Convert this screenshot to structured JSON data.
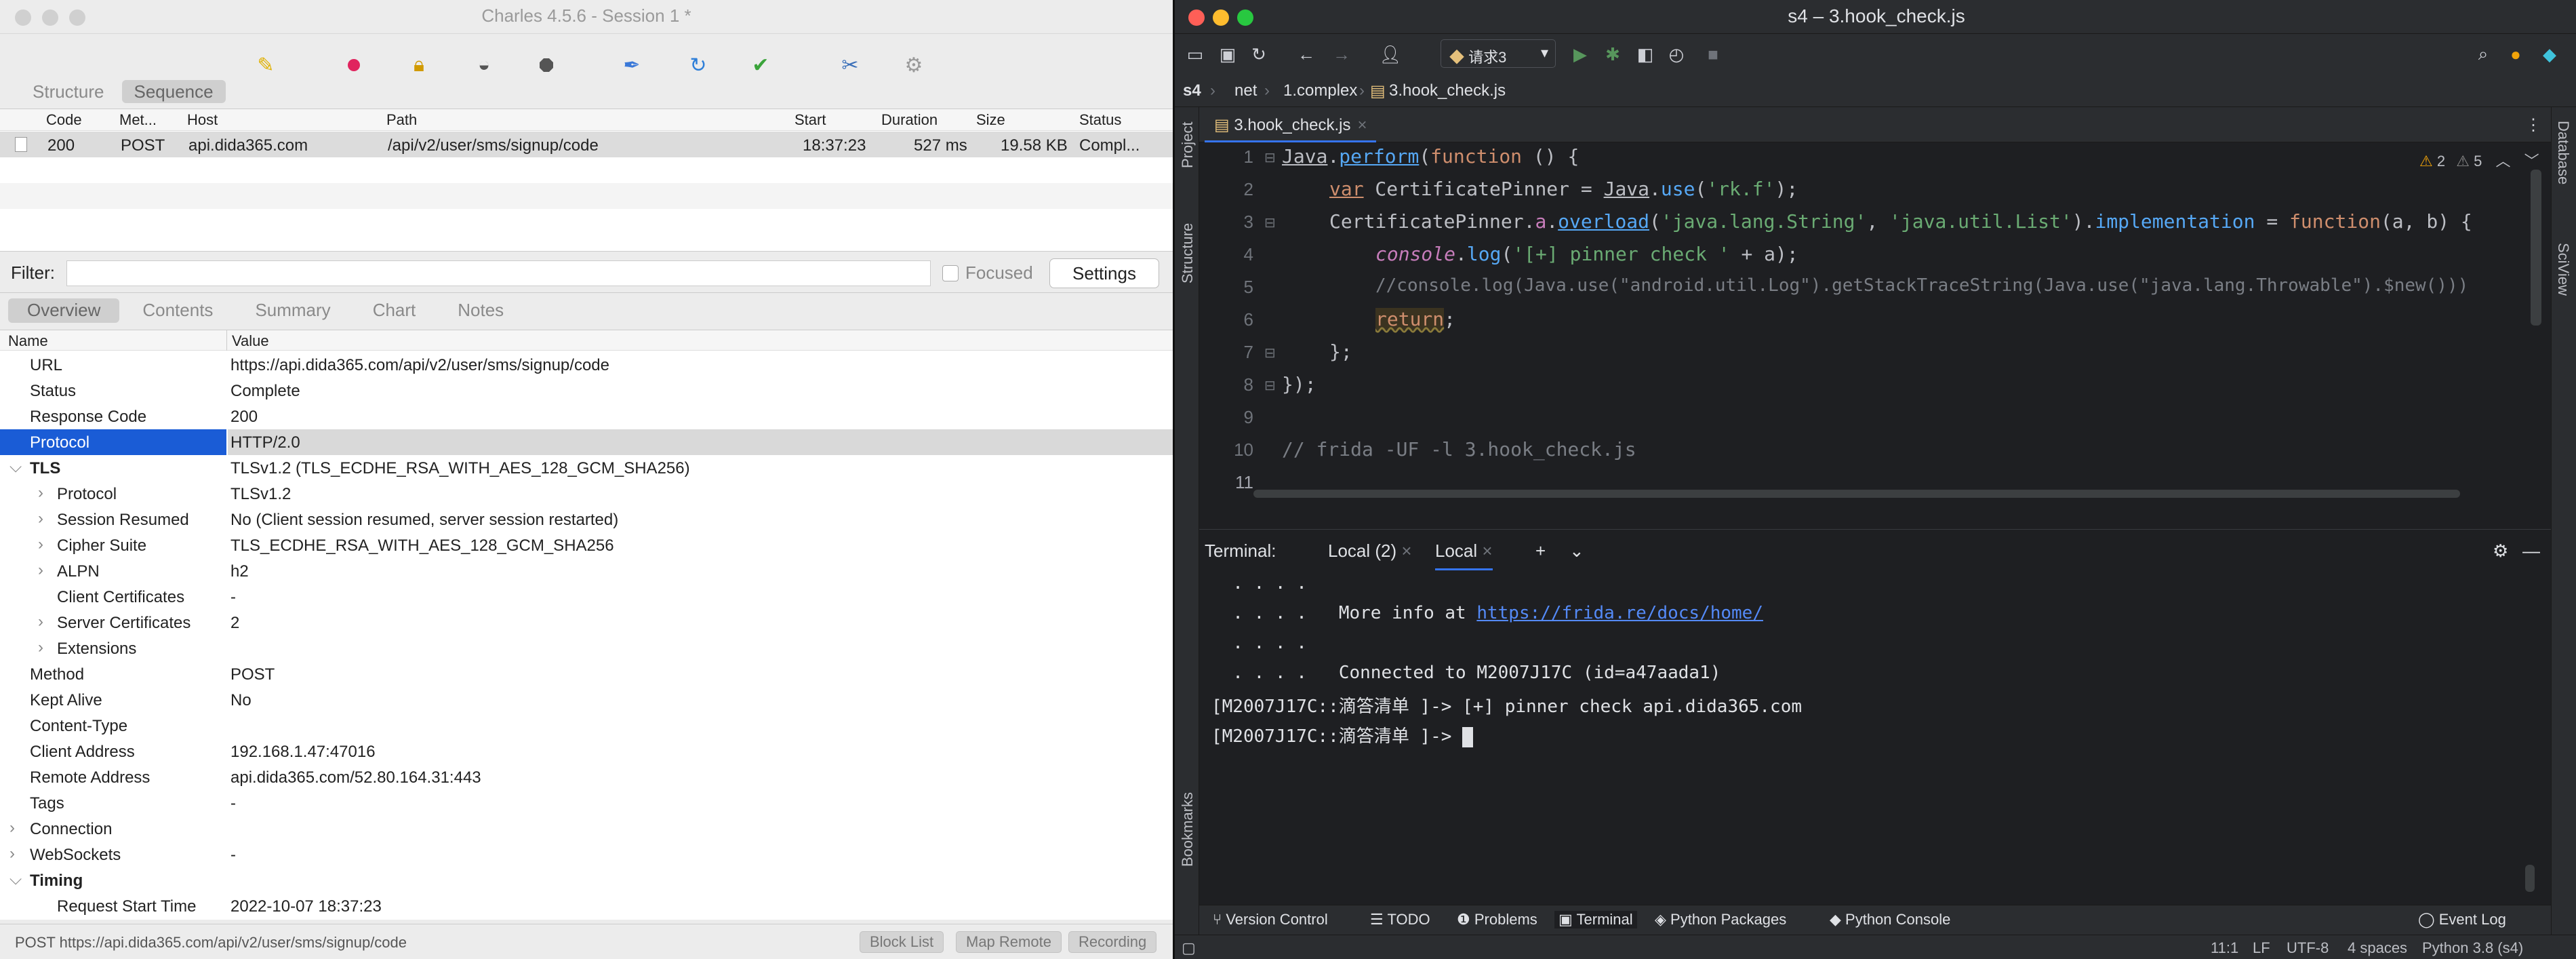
{
  "charles": {
    "title": "Charles 4.5.6 - Session 1 *",
    "view_tabs": [
      "Structure",
      "Sequence"
    ],
    "sequence_columns": [
      "Code",
      "Met...",
      "Host",
      "Path",
      "Start",
      "Duration",
      "Size",
      "Status"
    ],
    "sequence_rows": [
      {
        "code": "200",
        "method": "POST",
        "host": "api.dida365.com",
        "path": "/api/v2/user/sms/signup/code",
        "start": "18:37:23",
        "duration": "527 ms",
        "size": "19.58 KB",
        "status": "Compl..."
      }
    ],
    "filter_label": "Filter:",
    "focused_label": "Focused",
    "settings_label": "Settings",
    "detail_tabs": [
      "Overview",
      "Contents",
      "Summary",
      "Chart",
      "Notes"
    ],
    "detail_columns": [
      "Name",
      "Value"
    ],
    "detail_rows": [
      {
        "name": "URL",
        "value": "https://api.dida365.com/api/v2/user/sms/signup/code"
      },
      {
        "name": "Status",
        "value": "Complete"
      },
      {
        "name": "Response Code",
        "value": "200"
      },
      {
        "name": "Protocol",
        "value": "HTTP/2.0"
      },
      {
        "name": "TLS",
        "value": "TLSv1.2 (TLS_ECDHE_RSA_WITH_AES_128_GCM_SHA256)"
      },
      {
        "name": "Protocol",
        "value": "TLSv1.2"
      },
      {
        "name": "Session Resumed",
        "value": "No (Client session resumed, server session restarted)"
      },
      {
        "name": "Cipher Suite",
        "value": "TLS_ECDHE_RSA_WITH_AES_128_GCM_SHA256"
      },
      {
        "name": "ALPN",
        "value": "h2"
      },
      {
        "name": "Client Certificates",
        "value": "-"
      },
      {
        "name": "Server Certificates",
        "value": "2"
      },
      {
        "name": "Extensions",
        "value": ""
      },
      {
        "name": "Method",
        "value": "POST"
      },
      {
        "name": "Kept Alive",
        "value": "No"
      },
      {
        "name": "Content-Type",
        "value": ""
      },
      {
        "name": "Client Address",
        "value": "192.168.1.47:47016"
      },
      {
        "name": "Remote Address",
        "value": "api.dida365.com/52.80.164.31:443"
      },
      {
        "name": "Tags",
        "value": "-"
      },
      {
        "name": "Connection",
        "value": ""
      },
      {
        "name": "WebSockets",
        "value": "-"
      },
      {
        "name": "Timing",
        "value": ""
      },
      {
        "name": "Request Start Time",
        "value": "2022-10-07 18:37:23"
      }
    ],
    "status_text": "POST https://api.dida365.com/api/v2/user/sms/signup/code",
    "status_buttons": [
      "Block List",
      "Map Remote",
      "Recording"
    ]
  },
  "ide": {
    "title": "s4 – 3.hook_check.js",
    "run_config": "请求3",
    "breadcrumb": [
      "s4",
      "net",
      "1.complex",
      "3.hook_check.js"
    ],
    "editor_tab": "3.hook_check.js",
    "inspections": {
      "warnings": "2",
      "weak_warnings": "5"
    },
    "line_numbers": [
      "1",
      "2",
      "3",
      "4",
      "5",
      "6",
      "7",
      "8",
      "9",
      "10",
      "11"
    ],
    "code": {
      "l1": [
        "Java",
        ".",
        "perform",
        "(",
        "function",
        " () {"
      ],
      "l2": [
        "var",
        " CertificatePinner = ",
        "Java",
        ".",
        "use",
        "(",
        "'rk.f'",
        ");"
      ],
      "l3": [
        "CertificatePinner.",
        "a",
        ".",
        "overload",
        "(",
        "'java.lang.String'",
        ", ",
        "'java.util.List'",
        ").",
        "implementation",
        " = ",
        "function",
        "(a, b) {"
      ],
      "l4": [
        "console",
        ".",
        "log",
        "(",
        "'[+] pinner check '",
        " + a);"
      ],
      "l5": "//console.log(Java.use(\"android.util.Log\").getStackTraceString(Java.use(\"java.lang.Throwable\").$new()))",
      "l6": [
        "return",
        ";"
      ],
      "l7": "};",
      "l8": "});",
      "l10": "// frida -UF -l 3.hook_check.js"
    },
    "terminal": {
      "label": "Terminal:",
      "tabs": [
        "Local (2)",
        "Local"
      ],
      "lines": [
        "  . . . .",
        "  . . . .   More info at ",
        "  . . . .",
        "  . . . .   Connected to M2007J17C (id=a47aada1)",
        "[M2007J17C::滴答清单 ]-> [+] pinner check api.dida365.com",
        "[M2007J17C::滴答清单 ]-> "
      ],
      "link": "https://frida.re/docs/home/"
    },
    "left_strip": [
      "Project",
      "Structure",
      "Bookmarks"
    ],
    "right_strip": [
      "Database",
      "SciView"
    ],
    "bottom_tools": [
      "Version Control",
      "TODO",
      "Problems",
      "Terminal",
      "Python Packages",
      "Python Console",
      "Event Log"
    ],
    "status": {
      "position": "11:1",
      "line_sep": "LF",
      "encoding": "UTF-8",
      "indent": "4 spaces",
      "interpreter": "Python 3.8 (s4)"
    }
  }
}
